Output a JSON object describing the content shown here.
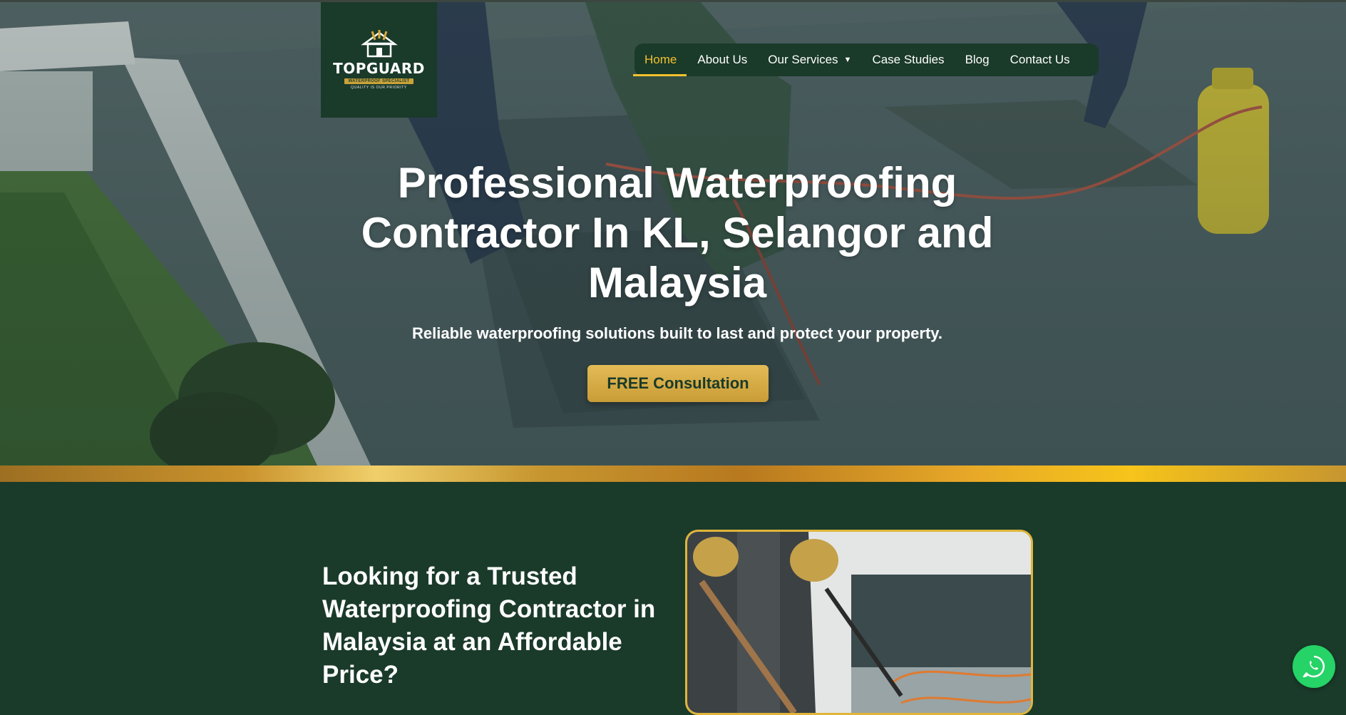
{
  "brand": {
    "name": "TOPGUARD",
    "tagline": "WATERPROOF SPECIALIST",
    "slogan": "QUALITY IS OUR PRIORITY"
  },
  "nav": {
    "items": [
      {
        "label": "Home",
        "active": true
      },
      {
        "label": "About Us",
        "active": false
      },
      {
        "label": "Our Services",
        "active": false,
        "has_dropdown": true
      },
      {
        "label": "Case Studies",
        "active": false
      },
      {
        "label": "Blog",
        "active": false
      },
      {
        "label": "Contact Us",
        "active": false
      }
    ]
  },
  "hero": {
    "title_lines": [
      "Professional Waterproofing",
      "Contractor In KL, Selangor and",
      "Malaysia"
    ],
    "subtitle": "Reliable waterproofing solutions built to last and protect your property.",
    "cta_label": "FREE Consultation"
  },
  "section": {
    "heading_lines": [
      "Looking for a Trusted",
      "Waterproofing Contractor in",
      "Malaysia at an Affordable",
      "Price?"
    ]
  },
  "icons": {
    "logo": "house-with-tools-icon",
    "dropdown": "chevron-down-icon",
    "whatsapp": "whatsapp-icon"
  },
  "colors": {
    "brand_green": "#1a3a2a",
    "accent_gold": "#f2c12e",
    "cta_gold": "#d9ad45",
    "whatsapp_green": "#25d366"
  }
}
